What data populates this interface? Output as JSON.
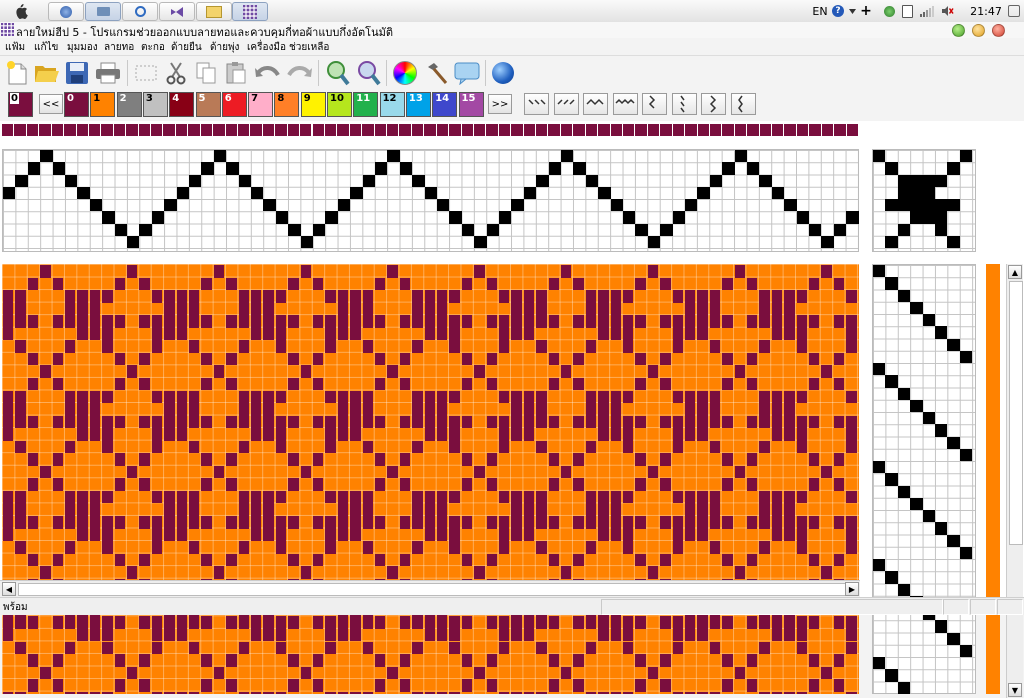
{
  "os_bar": {
    "language": "EN",
    "clock": "21:47",
    "task_buttons": [
      "finder",
      "browser",
      "quicktime",
      "visual-studio",
      "folder",
      "weave-app"
    ]
  },
  "window": {
    "title": "ลายใหม่ฮีป 5 - โปรแกรมช่วยออกแบบลายทอและควบคุมกี่ทอผ้าแบบกึ่งอัตโนมัติ"
  },
  "menu": [
    "แฟ้ม",
    "แก้ไข",
    "มุมมอง",
    "ลายทอ",
    "ตะกอ",
    "ด้ายยืน",
    "ด้ายพุ่ง",
    "เครื่องมือ",
    "ช่วยเหลือ"
  ],
  "toolbar": {
    "tools": [
      "new-file-icon",
      "open-folder-icon",
      "save-icon",
      "print-icon",
      "select-rect-icon",
      "cut-icon",
      "copy-icon",
      "paste-icon",
      "undo-icon",
      "redo-icon",
      "zoom-in-icon",
      "zoom-out-icon",
      "color-wheel-icon",
      "hammer-icon",
      "comment-icon",
      "globe-icon"
    ]
  },
  "palette": {
    "current_label": "0",
    "current_color": "#7a0e3e",
    "prev_label": "<<",
    "next_label": ">>",
    "colors": [
      {
        "label": "0",
        "color": "#7a0e3e"
      },
      {
        "label": "1",
        "color": "#ff8200"
      },
      {
        "label": "2",
        "color": "#7f7f7f"
      },
      {
        "label": "3",
        "color": "#c0c0c0"
      },
      {
        "label": "4",
        "color": "#880015"
      },
      {
        "label": "5",
        "color": "#b97a57"
      },
      {
        "label": "6",
        "color": "#ed1c24"
      },
      {
        "label": "7",
        "color": "#ffaec9"
      },
      {
        "label": "8",
        "color": "#ff7f27"
      },
      {
        "label": "9",
        "color": "#fff200"
      },
      {
        "label": "10",
        "color": "#b5e61d"
      },
      {
        "label": "11",
        "color": "#22b14c"
      },
      {
        "label": "12",
        "color": "#99d9ea"
      },
      {
        "label": "13",
        "color": "#00a2e8"
      },
      {
        "label": "14",
        "color": "#3f48cc"
      },
      {
        "label": "15",
        "color": "#a349a4"
      }
    ],
    "pattern_buttons": [
      "diag-down-pattern-icon",
      "diag-up-pattern-icon",
      "zigzag-pattern-icon",
      "wave-pattern-icon",
      "vertical-zigzag-pattern-icon",
      "vertical-diag-pattern-icon",
      "vertical-zigzag2-pattern-icon",
      "vertical-wave-pattern-icon"
    ]
  },
  "design": {
    "warp_color": "#7a0e3e",
    "weft_color": "#ff8200",
    "threading_peak_period": 14
  },
  "status": {
    "text": "พร้อม"
  }
}
